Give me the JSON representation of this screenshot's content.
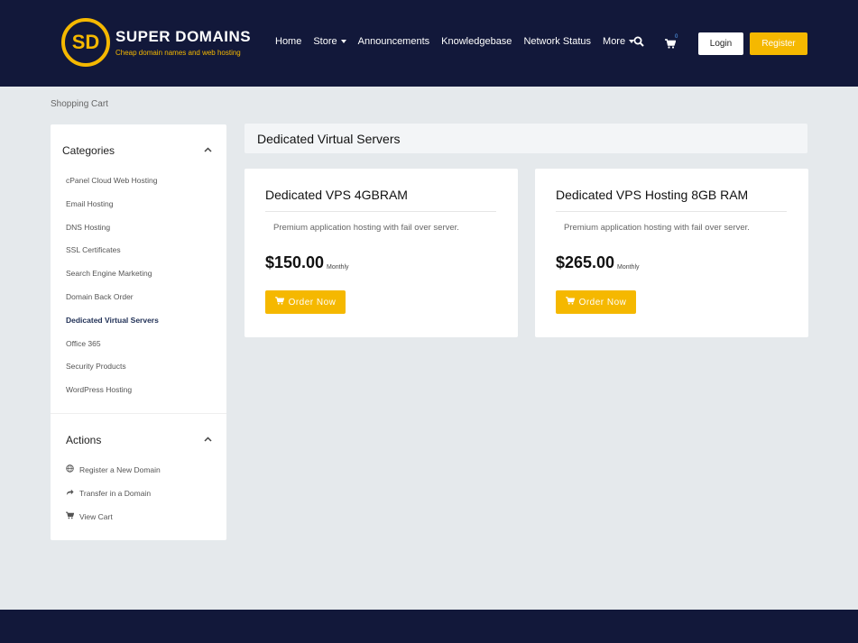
{
  "header": {
    "brand": "SUPER DOMAINS",
    "logo_glyph": "SD",
    "tagline": "Cheap domain names and web hosting",
    "nav": [
      {
        "label": "Home",
        "has_caret": false
      },
      {
        "label": "Store",
        "has_caret": true
      },
      {
        "label": "Announcements",
        "has_caret": false
      },
      {
        "label": "Knowledgebase",
        "has_caret": false
      },
      {
        "label": "Network Status",
        "has_caret": false
      },
      {
        "label": "More",
        "has_caret": true
      }
    ],
    "search_icon": "search-icon",
    "cart_icon": "cart-icon",
    "cart_count": "0",
    "login_label": "Login",
    "register_label": "Register"
  },
  "breadcrumb": "Shopping Cart",
  "sidebar": {
    "categories_title": "Categories",
    "categories": [
      {
        "label": "cPanel Cloud Web Hosting",
        "active": false
      },
      {
        "label": "Email Hosting",
        "active": false
      },
      {
        "label": "DNS Hosting",
        "active": false
      },
      {
        "label": "SSL Certificates",
        "active": false
      },
      {
        "label": "Search Engine Marketing",
        "active": false
      },
      {
        "label": "Domain Back Order",
        "active": false
      },
      {
        "label": "Dedicated Virtual Servers",
        "active": true
      },
      {
        "label": "Office 365",
        "active": false
      },
      {
        "label": "Security Products",
        "active": false
      },
      {
        "label": "WordPress Hosting",
        "active": false
      }
    ],
    "actions_title": "Actions",
    "actions": [
      {
        "label": "Register a New Domain",
        "icon": "globe-icon"
      },
      {
        "label": "Transfer in a Domain",
        "icon": "share-icon"
      },
      {
        "label": "View Cart",
        "icon": "cart-icon"
      }
    ]
  },
  "main": {
    "title": "Dedicated Virtual Servers",
    "products": [
      {
        "name": "Dedicated VPS 4GBRAM",
        "description": "Premium application hosting with fail over server.",
        "price": "$150.00",
        "cycle": "Monthly",
        "button": "Order Now"
      },
      {
        "name": "Dedicated VPS Hosting 8GB RAM",
        "description": "Premium application hosting with fail over server.",
        "price": "$265.00",
        "cycle": "Monthly",
        "button": "Order Now"
      }
    ]
  },
  "colors": {
    "navy": "#12183a",
    "accent": "#f5b800",
    "page_bg": "#e5e9ec"
  }
}
